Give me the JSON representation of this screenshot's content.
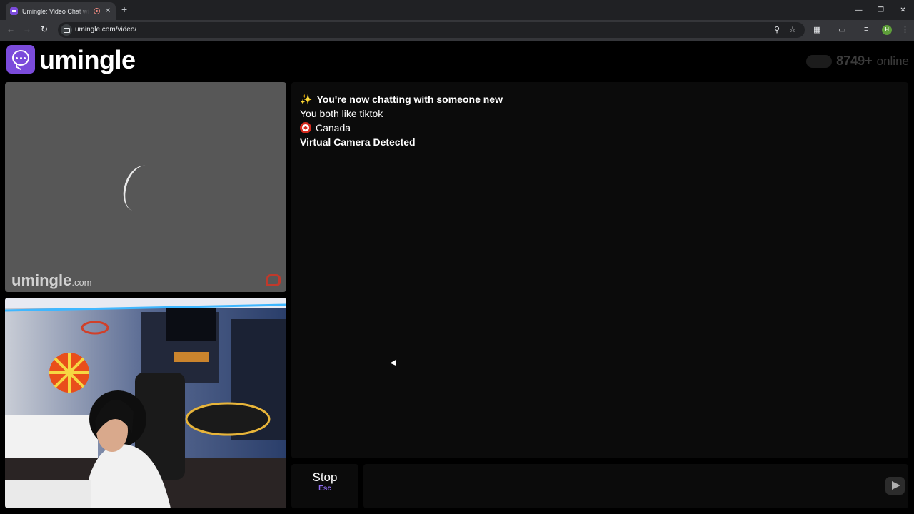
{
  "browser": {
    "tab_title": "Umingle: Video Chat with Strangers",
    "tab_close": "✕",
    "new_tab": "+",
    "url": "umingle.com/video/",
    "profile_initial": "H",
    "icons": [
      "back-icon",
      "forward-icon",
      "reload-icon",
      "zoom-icon",
      "star-icon",
      "extensions-icon",
      "cast-icon",
      "media-icon",
      "menu-icon"
    ]
  },
  "site": {
    "brand": "umingle",
    "brand_color": "#7b4bdb",
    "online_count": "8749+",
    "online_label": "online"
  },
  "stranger_video": {
    "watermark": "umingle",
    "watermark_suffix": ".com"
  },
  "chat": {
    "messages": [
      {
        "icon": "✨",
        "text": "You're now chatting with someone new",
        "bold": true
      },
      {
        "text": "You both like tiktok",
        "bold": false
      },
      {
        "icon": "flag-canada",
        "text": "Canada",
        "bold": false
      },
      {
        "text": "Virtual Camera Detected",
        "bold": true
      }
    ],
    "input_placeholder": ""
  },
  "controls": {
    "stop_label": "Stop",
    "stop_hint": "Esc"
  }
}
